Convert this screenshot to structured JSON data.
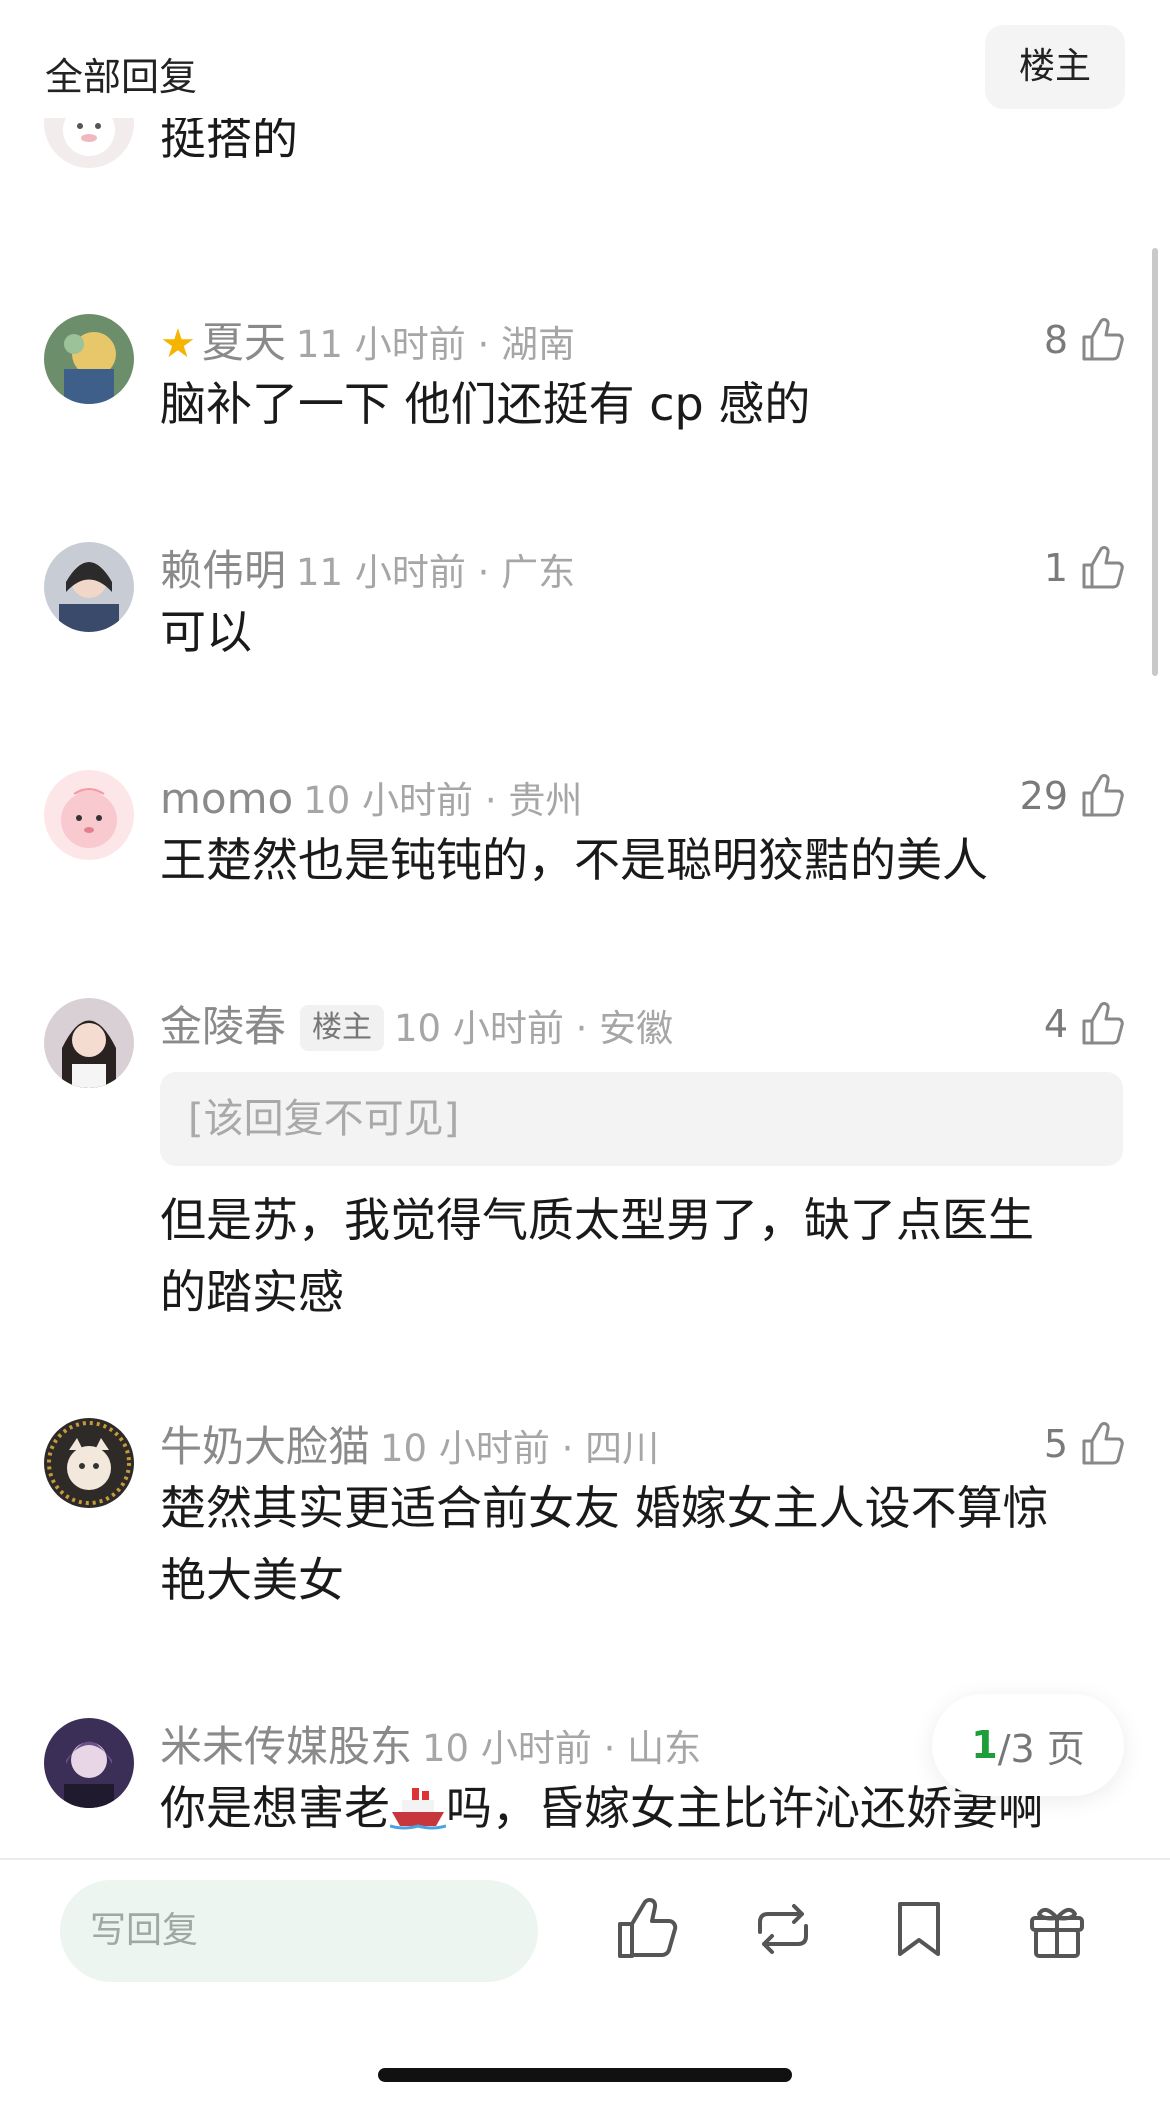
{
  "header": {
    "title": "全部回复",
    "op_button": "楼主"
  },
  "comments": [
    {
      "name": "",
      "time": "",
      "likes": "",
      "text": "挺搭的"
    },
    {
      "name": "夏天",
      "time": "11 小时前 · 湖南",
      "likes": "8",
      "text": "脑补了一下 他们还挺有 cp 感的"
    },
    {
      "name": "赖伟明",
      "time": "11 小时前 · 广东",
      "likes": "1",
      "text": "可以"
    },
    {
      "name": "momo",
      "time": "10 小时前 · 贵州",
      "likes": "29",
      "text": "王楚然也是钝钝的，不是聪明狡黠的美人"
    },
    {
      "name": "金陵春",
      "badge": "楼主",
      "time": "10 小时前 · 安徽",
      "likes": "4",
      "quote": "[该回复不可见]",
      "text_l1": "但是苏，我觉得气质太型男了，缺了点医生",
      "text_l2": "的踏实感"
    },
    {
      "name": "牛奶大脸猫",
      "time": "10 小时前 · 四川",
      "likes": "5",
      "text_l1": "楚然其实更适合前女友 婚嫁女主人设不算惊",
      "text_l2": "艳大美女"
    },
    {
      "name": "米未传媒股东",
      "time": "10 小时前 · 山东",
      "text_a": "你是想害老",
      "text_b": "吗，昏嫁女主比许沁还娇妻啊"
    }
  ],
  "pager": {
    "current": "1",
    "total": "/3 页"
  },
  "bottom": {
    "reply_placeholder": "写回复"
  },
  "icons": [
    "thumb-up-icon",
    "repost-icon",
    "bookmark-icon",
    "gift-icon",
    "ship-emoji",
    "star-badge-icon"
  ],
  "colors": {
    "accent_green": "#1e9e3a",
    "input_bg": "#edf5f0"
  }
}
